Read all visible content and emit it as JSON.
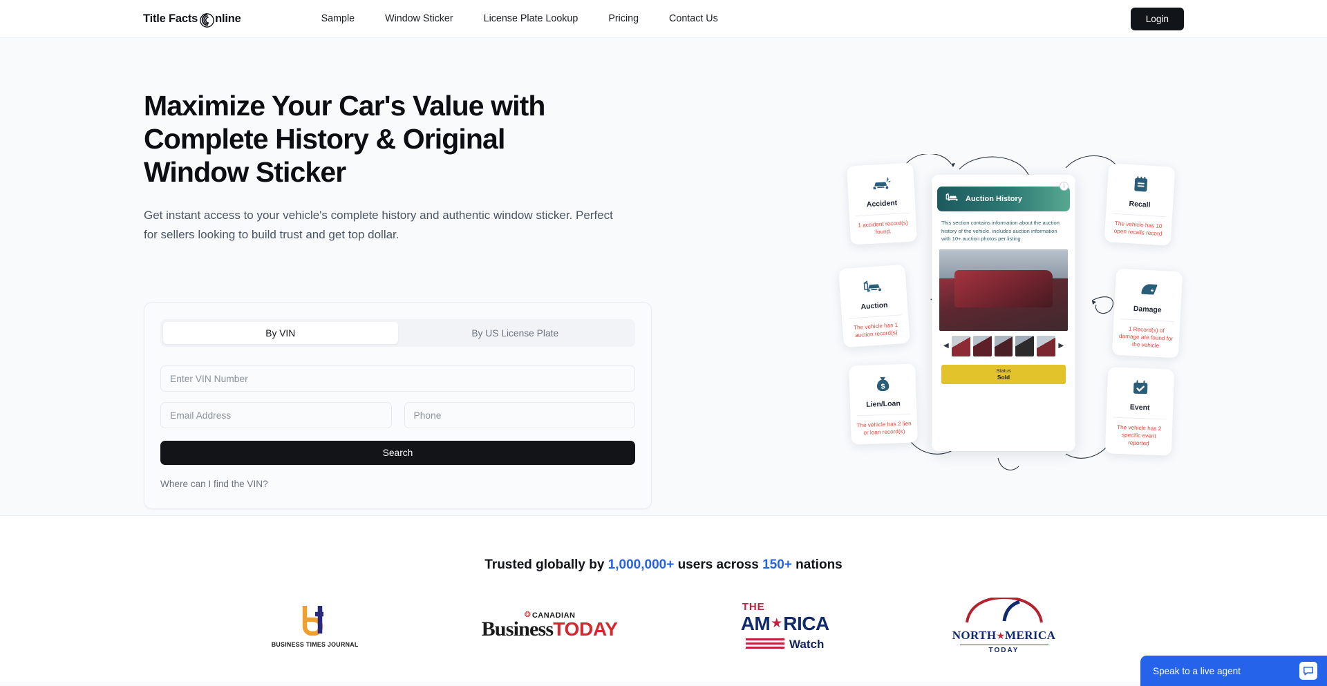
{
  "header": {
    "logo_text_1": "Title Facts",
    "logo_text_2": "nline",
    "logo_icon": "spiral-circle-icon",
    "nav": [
      {
        "label": "Sample"
      },
      {
        "label": "Window Sticker"
      },
      {
        "label": "License Plate Lookup"
      },
      {
        "label": "Pricing"
      },
      {
        "label": "Contact Us"
      }
    ],
    "login_label": "Login"
  },
  "hero": {
    "title": "Maximize Your Car's Value with Complete History & Original Window Sticker",
    "subtitle": "Get instant access to your vehicle's complete history and authentic window sticker. Perfect for sellers looking to build trust and get top dollar.",
    "search": {
      "tabs": [
        {
          "label": "By VIN",
          "active": true
        },
        {
          "label": "By US License Plate",
          "active": false
        }
      ],
      "vin_placeholder": "Enter VIN Number",
      "vin_value": "",
      "email_placeholder": "Email Address",
      "email_value": "",
      "phone_placeholder": "Phone",
      "phone_value": "",
      "submit_label": "Search",
      "help_link": "Where can I find the VIN?"
    }
  },
  "illustration": {
    "cards": [
      {
        "id": "accident",
        "icon": "car-crash-icon",
        "title": "Accident",
        "desc": "1 accident record(s) found."
      },
      {
        "id": "auction",
        "icon": "car-auction-icon",
        "title": "Auction",
        "desc": "The vehicle has 1 auction record(s)"
      },
      {
        "id": "lien",
        "icon": "money-bag-icon",
        "title": "Lien/Loan",
        "desc": "The vehicle has 2 lien or loan record(s)"
      },
      {
        "id": "recall",
        "icon": "notebook-icon",
        "title": "Recall",
        "desc": "The vehicle has 10 open recalls record"
      },
      {
        "id": "damage",
        "icon": "car-door-icon",
        "title": "Damage",
        "desc": "1 Record(s) of damage are found for the vehicle"
      },
      {
        "id": "event",
        "icon": "calendar-check-icon",
        "title": "Event",
        "desc": "The vehicle has 2 specific event reported"
      }
    ],
    "phone": {
      "banner_title": "Auction History",
      "banner_icon": "car-auction-icon",
      "info_badge": "i",
      "body_text": "This section contains information about the auction history of the vehicle. includes auction information with 10+ auction photos per listing",
      "status_label": "Status",
      "status_value": "Sold"
    }
  },
  "trusted": {
    "prefix": "Trusted globally by ",
    "users": "1,000,000+",
    "middle": " users across ",
    "nations": "150+",
    "suffix": " nations",
    "logos": [
      {
        "name": "Business Times Journal",
        "caption": "BUSINESS TIMES JOURNAL"
      },
      {
        "name": "Canadian Business Today",
        "part1": "CANADIAN",
        "part2": "Business",
        "part3": "TODAY"
      },
      {
        "name": "The America Watch",
        "part1": "THE",
        "part2": "AM",
        "part3": "RICA",
        "part4": "Watch"
      },
      {
        "name": "North America Today",
        "part1": "NORTH ",
        "part2": "MERICA",
        "part3": "TODAY"
      }
    ]
  },
  "chat": {
    "label": "Speak to a live agent",
    "icon": "chat-bubble-icon"
  },
  "colors": {
    "accent_blue": "#2563eb",
    "dark": "#121417",
    "alert_red": "#f04438",
    "status_yellow": "#e3c32c"
  }
}
